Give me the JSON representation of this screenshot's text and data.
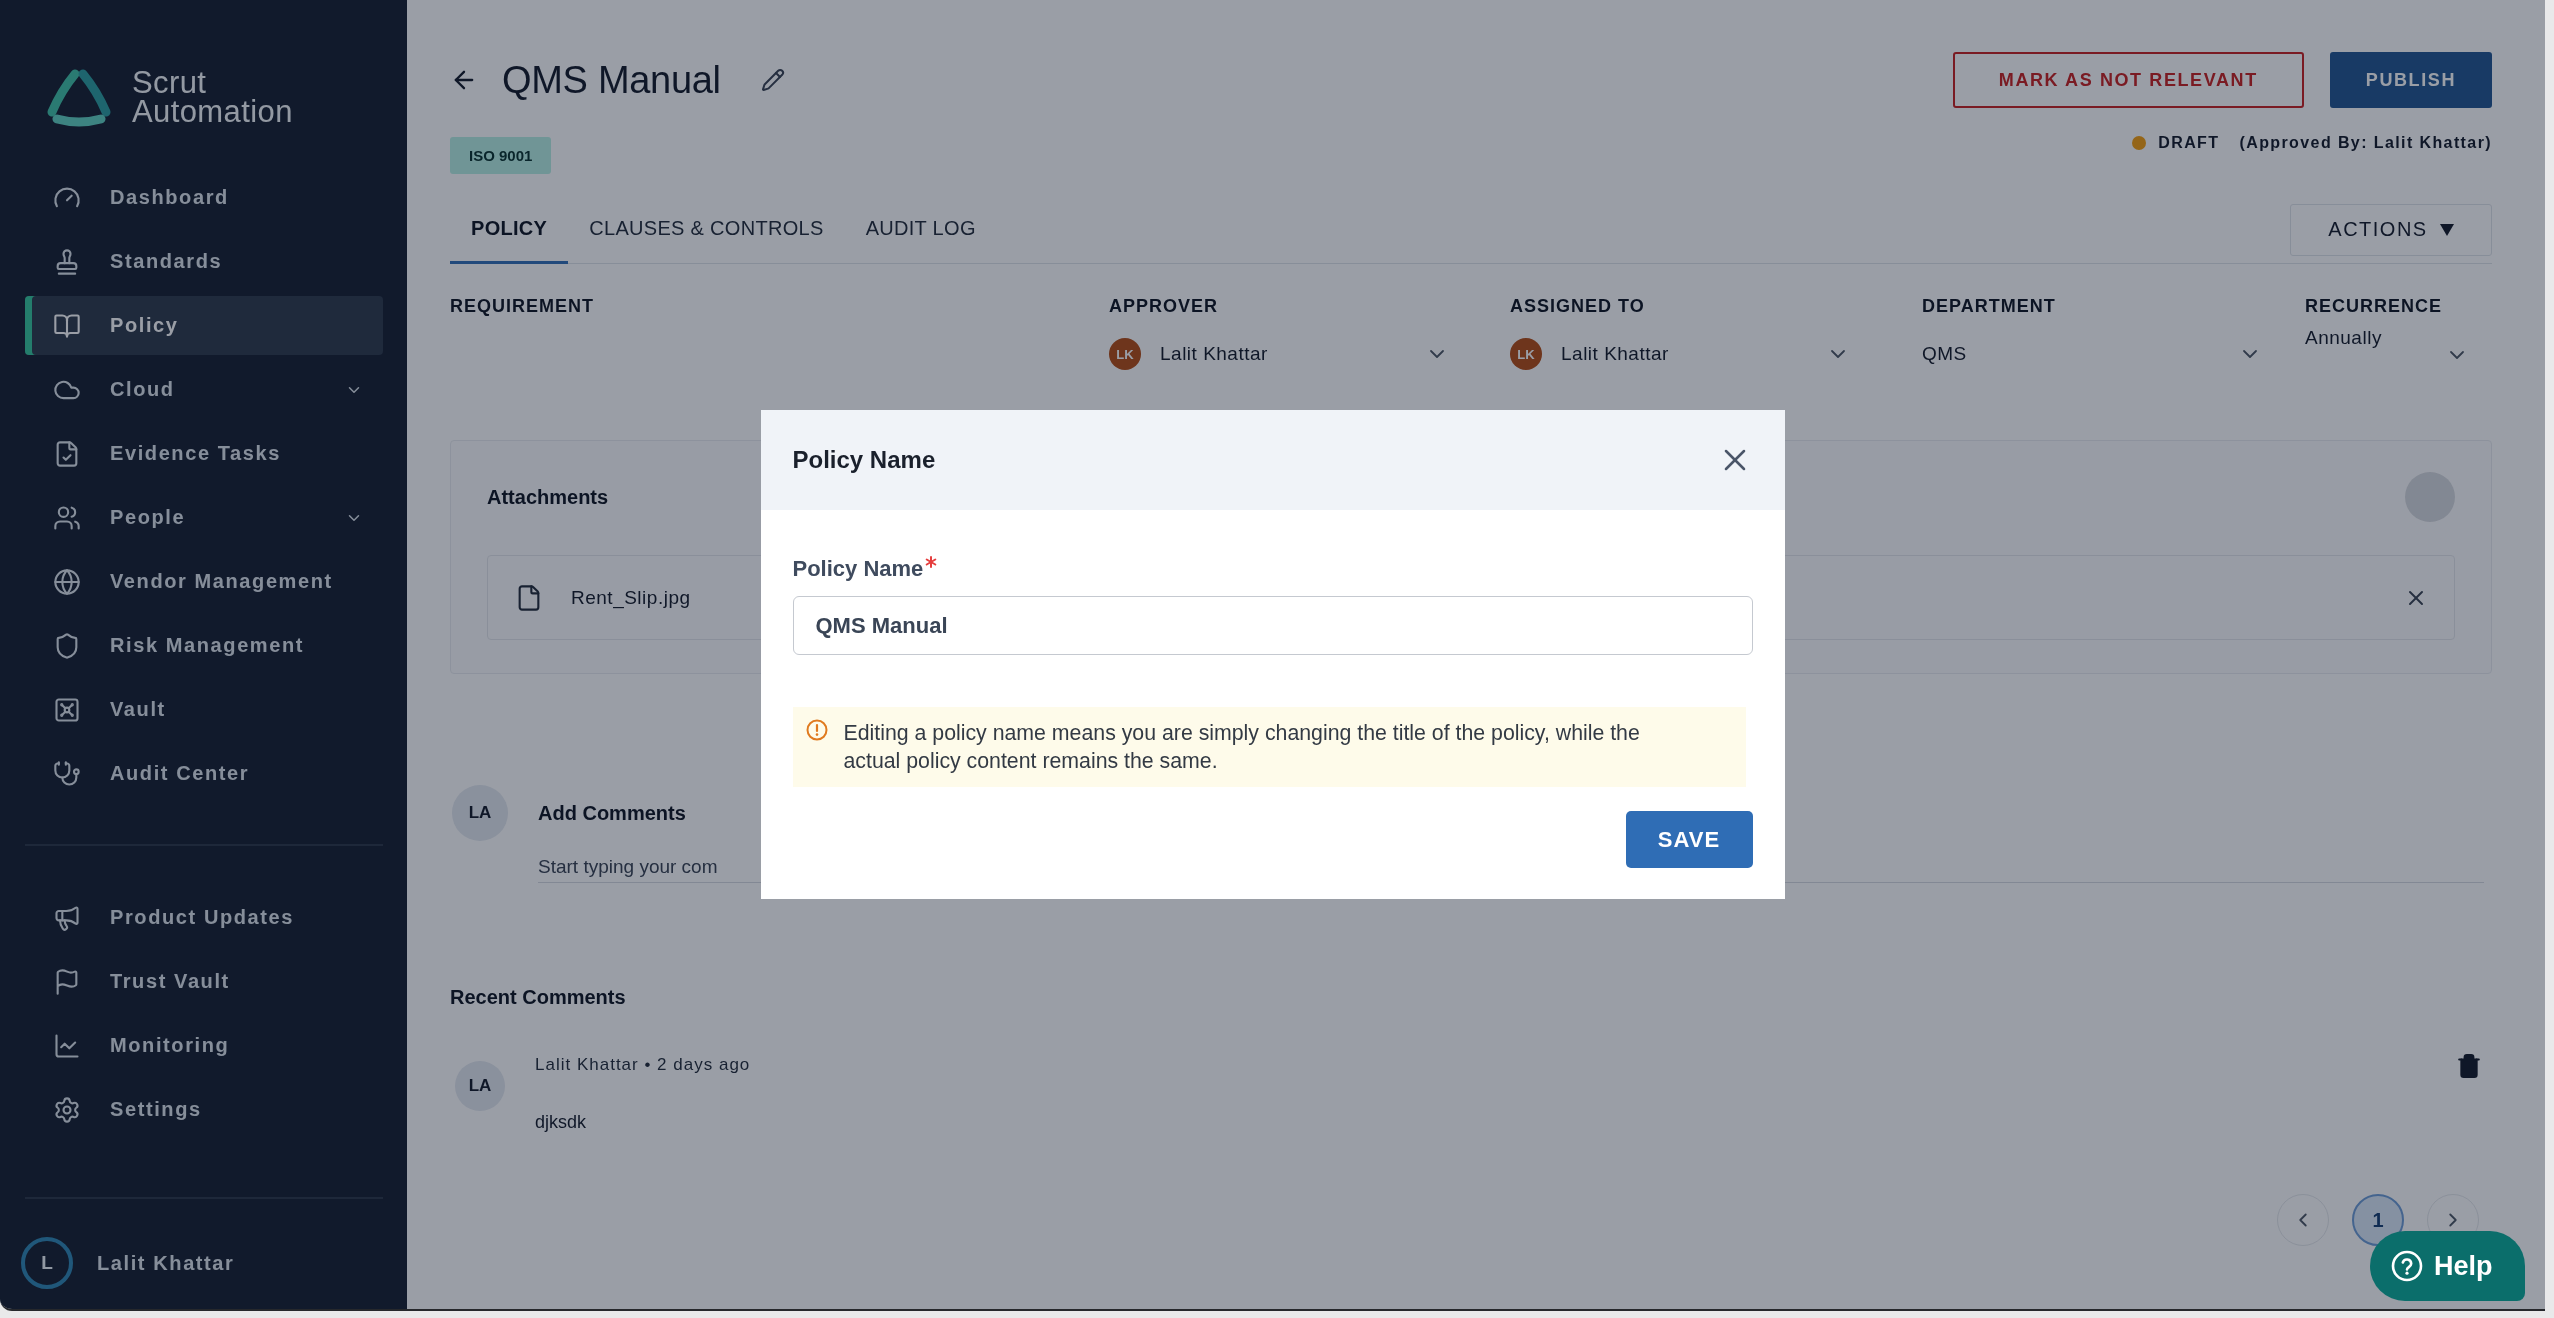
{
  "sidebar": {
    "logo_lines": [
      "Scrut",
      "Automation"
    ],
    "items": [
      {
        "label": "Dashboard",
        "selected": false,
        "expandable": false
      },
      {
        "label": "Standards",
        "selected": false,
        "expandable": false
      },
      {
        "label": "Policy",
        "selected": true,
        "expandable": false
      },
      {
        "label": "Cloud",
        "selected": false,
        "expandable": true
      },
      {
        "label": "Evidence Tasks",
        "selected": false,
        "expandable": false
      },
      {
        "label": "People",
        "selected": false,
        "expandable": true
      },
      {
        "label": "Vendor Management",
        "selected": false,
        "expandable": false
      },
      {
        "label": "Risk Management",
        "selected": false,
        "expandable": false
      },
      {
        "label": "Vault",
        "selected": false,
        "expandable": false
      },
      {
        "label": "Audit Center",
        "selected": false,
        "expandable": false
      }
    ],
    "secondary_items": [
      {
        "label": "Product Updates",
        "selected": false,
        "expandable": false
      },
      {
        "label": "Trust Vault",
        "selected": false,
        "expandable": false
      },
      {
        "label": "Monitoring",
        "selected": false,
        "expandable": false
      },
      {
        "label": "Settings",
        "selected": false,
        "expandable": false
      }
    ],
    "user": {
      "initial": "L",
      "name": "Lalit Khattar"
    }
  },
  "page": {
    "title": "QMS Manual",
    "badge": "ISO 9001",
    "buttons": [
      {
        "label": "MARK AS NOT RELEVANT",
        "kind": "outline"
      },
      {
        "label": "PUBLISH",
        "kind": "primary"
      }
    ],
    "status": {
      "label": "DRAFT",
      "approval": "(Approved By: Lalit Khattar)"
    }
  },
  "tabs": [
    {
      "label": "POLICY",
      "selected": true
    },
    {
      "label": "CLAUSES & CONTROLS",
      "selected": false
    },
    {
      "label": "AUDIT LOG",
      "selected": false
    }
  ],
  "actions_button": {
    "label": "ACTIONS"
  },
  "fields": [
    {
      "kind": "label_only",
      "label": "REQUIREMENT"
    },
    {
      "kind": "person",
      "label": "APPROVER",
      "initials": "LK",
      "value": "Lalit Khattar"
    },
    {
      "kind": "person",
      "label": "ASSIGNED TO",
      "initials": "LK",
      "value": "Lalit Khattar"
    },
    {
      "kind": "select",
      "label": "DEPARTMENT",
      "value": "QMS"
    },
    {
      "kind": "compact",
      "label": "RECURRENCE",
      "value": "Annually"
    }
  ],
  "attachments": {
    "title": "Attachments",
    "files": [
      {
        "name": "Rent_Slip.jpg"
      }
    ]
  },
  "add_comment": {
    "initials": "LA",
    "title": "Add Comments",
    "placeholder": "Start typing your com"
  },
  "recent_comments": {
    "title": "Recent Comments",
    "items": [
      {
        "initials": "LA",
        "meta": "Lalit Khattar • 2 days ago",
        "text": "djksdk"
      }
    ]
  },
  "pagination": [
    {
      "label": "1",
      "selected": true
    }
  ],
  "modal": {
    "title": "Policy Name",
    "field": {
      "label": "Policy Name",
      "required": true,
      "value": "QMS Manual"
    },
    "notice": "Editing a policy name means you are simply changing the title of the policy, while the actual policy content remains the same.",
    "button": "SAVE"
  },
  "help_button": {
    "label": "Help"
  }
}
